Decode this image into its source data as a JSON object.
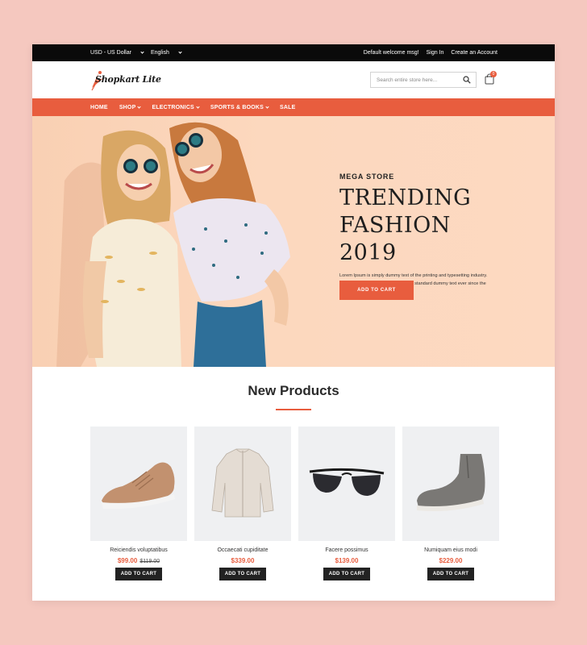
{
  "topbar": {
    "currency": "USD - US Dollar",
    "language": "English",
    "welcome": "Default welcome msg!",
    "sign_in": "Sign In",
    "create_account": "Create an Account"
  },
  "header": {
    "logo_text": "Shopkart Lite",
    "search_placeholder": "Search entire store here...",
    "cart_count": "0"
  },
  "nav": {
    "items": [
      {
        "label": "HOME"
      },
      {
        "label": "SHOP"
      },
      {
        "label": "ELECTRONICS"
      },
      {
        "label": "SPORTS & BOOKS"
      },
      {
        "label": "SALE"
      }
    ]
  },
  "hero": {
    "eyebrow": "MEGA STORE",
    "headline_line1": "TRENDING",
    "headline_line2": "FASHION 2019",
    "description": "Lorem Ipsum is simply dummy text of the printing and typesetting industry. Lorem Ipsum has been the industry's standard dummy text ever since the 1500s.",
    "cta": "ADD TO CART"
  },
  "new_products": {
    "title": "New Products",
    "items": [
      {
        "name": "Reiciendis voluptatibus",
        "price": "$99.00",
        "old_price": "$119.00",
        "button": "ADD TO CART",
        "icon": "sneaker"
      },
      {
        "name": "Occaecati cupiditate",
        "price": "$339.00",
        "old_price": "",
        "button": "ADD TO CART",
        "icon": "jacket"
      },
      {
        "name": "Facere possimus",
        "price": "$139.00",
        "old_price": "",
        "button": "ADD TO CART",
        "icon": "sunglasses"
      },
      {
        "name": "Numiquam eius modi",
        "price": "$229.00",
        "old_price": "",
        "button": "ADD TO CART",
        "icon": "chelsea-boot"
      }
    ]
  },
  "colors": {
    "accent": "#e85d3e",
    "topbar_bg": "#0a0a0a",
    "background": "#f5c8bf"
  }
}
